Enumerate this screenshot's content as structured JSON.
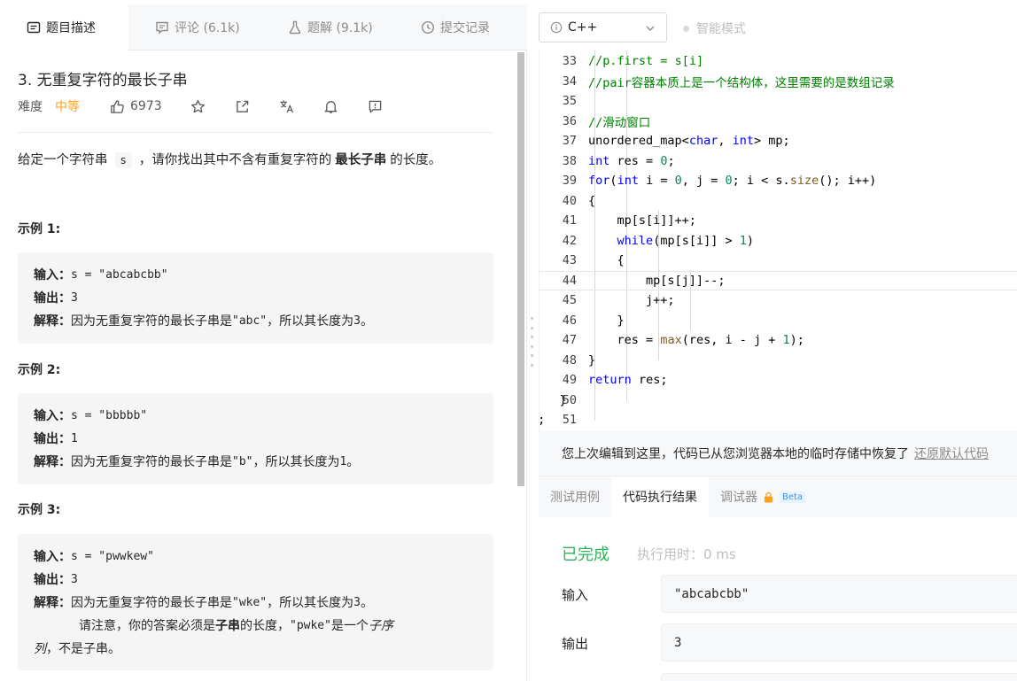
{
  "left_tabs": [
    {
      "label": "题目描述",
      "icon": "description-icon"
    },
    {
      "label": "评论 (6.1k)",
      "icon": "comment-icon"
    },
    {
      "label": "题解 (9.1k)",
      "icon": "flask-icon"
    },
    {
      "label": "提交记录",
      "icon": "clock-icon"
    }
  ],
  "language": "C++",
  "smart_mode": "智能模式",
  "problem": {
    "title": "3. 无重复字符的最长子串",
    "difficulty_label": "难度",
    "difficulty": "中等",
    "likes": "6973",
    "desc_before": "给定一个字符串",
    "desc_code": "s",
    "desc_middle": "，请你找出其中不含有重复字符的",
    "desc_bold": "最长子串",
    "desc_after": "的长度。"
  },
  "examples": [
    {
      "label": "示例 1:",
      "input_key": "输入：",
      "input": "s = \"abcabcbb\"",
      "output_key": "输出：",
      "output": "3",
      "explain_key": "解释：",
      "explain_pre": "因为无重复字符的最长子串是 ",
      "explain_code": "\"abc\"",
      "explain_mid": "，所以其长度为 ",
      "explain_num": "3",
      "explain_end": "。"
    },
    {
      "label": "示例 2:",
      "input_key": "输入：",
      "input": "s = \"bbbbb\"",
      "output_key": "输出：",
      "output": "1",
      "explain_key": "解释：",
      "explain_pre": "因为无重复字符的最长子串是 ",
      "explain_code": "\"b\"",
      "explain_mid": "，所以其长度为 ",
      "explain_num": "1",
      "explain_end": "。"
    },
    {
      "label": "示例 3:",
      "input_key": "输入：",
      "input": "s = \"pwwkew\"",
      "output_key": "输出：",
      "output": "3",
      "explain_key": "解释：",
      "explain_pre": "因为无重复字符的最长子串是 ",
      "explain_code": "\"wke\"",
      "explain_mid": "，所以其长度为 ",
      "explain_num": "3",
      "explain_end": "。",
      "note_pre": "请注意，你的答案必须是 ",
      "note_bold": "子串",
      "note_mid": " 的长度，",
      "note_code": "\"pwke\"",
      "note_post": " 是一个 ",
      "note_italic1": "子序",
      "note_italic2": "列",
      "note_end": "，不是子串。"
    }
  ],
  "code_lines": [
    {
      "n": "33",
      "text": "        //p.first = s[i]"
    },
    {
      "n": "34",
      "text": "        //pair容器本质上是一个结构体，这里需要的是数组记录"
    },
    {
      "n": "35",
      "text": ""
    },
    {
      "n": "36",
      "text": "        //滑动窗口"
    },
    {
      "n": "37",
      "text": "        unordered_map<char, int> mp;"
    },
    {
      "n": "38",
      "text": "        int res = 0;"
    },
    {
      "n": "39",
      "text": "        for(int i = 0, j = 0; i < s.size(); i++)"
    },
    {
      "n": "40",
      "text": "        {"
    },
    {
      "n": "41",
      "text": "            mp[s[i]]++;"
    },
    {
      "n": "42",
      "text": "            while(mp[s[i]] > 1)"
    },
    {
      "n": "43",
      "text": "            {"
    },
    {
      "n": "44",
      "text": "                mp[s[j]]--;"
    },
    {
      "n": "45",
      "text": "                j++;"
    },
    {
      "n": "46",
      "text": "            }"
    },
    {
      "n": "47",
      "text": "            res = max(res, i - j + 1);"
    },
    {
      "n": "48",
      "text": "        }"
    },
    {
      "n": "49",
      "text": "        return res;"
    },
    {
      "n": "50",
      "text": "    }"
    },
    {
      "n": "51",
      "text": "};"
    }
  ],
  "restore": {
    "message": "您上次编辑到这里，代码已从您浏览器本地的临时存储中恢复了",
    "link": "还原默认代码"
  },
  "result_tabs": [
    {
      "label": "测试用例"
    },
    {
      "label": "代码执行结果"
    },
    {
      "label": "调试器",
      "badge": "Beta"
    }
  ],
  "result": {
    "status": "已完成",
    "runtime": "执行用时：0 ms",
    "input_label": "输入",
    "input_value": "\"abcabcbb\"",
    "output_label": "输出",
    "output_value": "3"
  },
  "colors": {
    "accent_orange": "#ffa116",
    "success_green": "#2db55d",
    "code_keyword": "#0000ff",
    "code_comment": "#008000",
    "code_number": "#098658",
    "code_function": "#795e26"
  }
}
